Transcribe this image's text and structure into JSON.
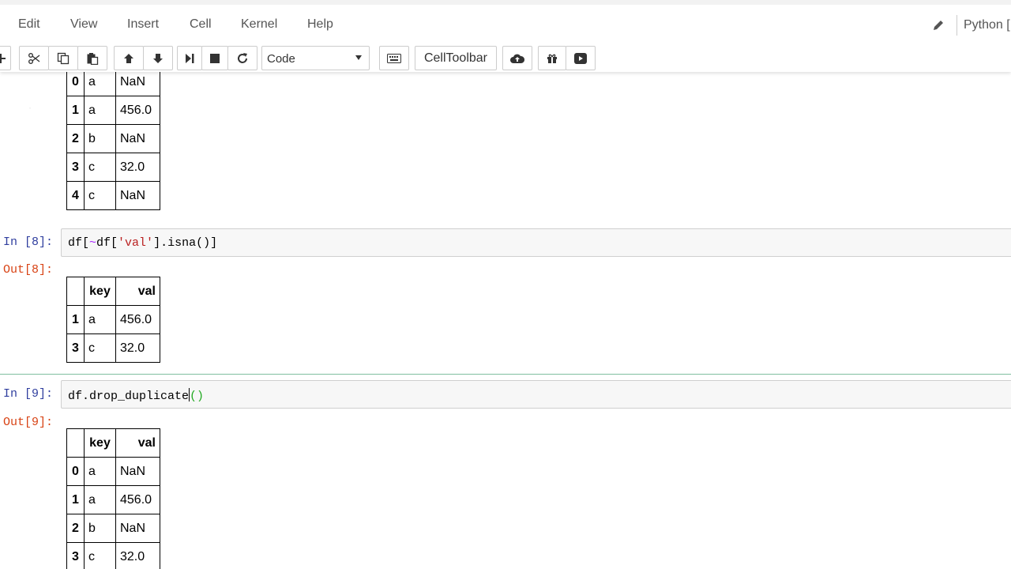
{
  "menubar": {
    "items": [
      "Edit",
      "View",
      "Insert",
      "Cell",
      "Kernel",
      "Help"
    ],
    "kernel_name": "Python ["
  },
  "toolbar": {
    "cell_type": "Code",
    "celltoolbar_label": "CellToolbar",
    "icons": [
      "insert-cell-icon",
      "cut-icon",
      "copy-icon",
      "paste-icon",
      "move-up-icon",
      "move-down-icon",
      "run-icon",
      "stop-icon",
      "restart-icon",
      "keyboard-icon",
      "upload-icon",
      "gift-icon",
      "present-icon"
    ]
  },
  "cells": {
    "cell7": {
      "rows": [
        [
          "0",
          "a",
          "NaN"
        ],
        [
          "1",
          "a",
          "456.0"
        ],
        [
          "2",
          "b",
          "NaN"
        ],
        [
          "3",
          "c",
          "32.0"
        ],
        [
          "4",
          "c",
          "NaN"
        ]
      ]
    },
    "cell8": {
      "in_prompt": "In [8]:",
      "out_prompt": "Out[8]:",
      "code": {
        "a": "df[",
        "b": "~",
        "c": "df[",
        "d": "'val'",
        "e": "].isna()]"
      },
      "columns": [
        "",
        "key",
        "val"
      ],
      "rows": [
        [
          "1",
          "a",
          "456.0"
        ],
        [
          "3",
          "c",
          "32.0"
        ]
      ]
    },
    "cell9": {
      "in_prompt": "In [9]:",
      "out_prompt": "Out[9]:",
      "code": {
        "a": "df.drop_duplicate",
        "b": "()"
      },
      "columns": [
        "",
        "key",
        "val"
      ],
      "rows": [
        [
          "0",
          "a",
          "NaN"
        ],
        [
          "1",
          "a",
          "456.0"
        ],
        [
          "2",
          "b",
          "NaN"
        ],
        [
          "3",
          "c",
          "32.0"
        ]
      ]
    }
  }
}
